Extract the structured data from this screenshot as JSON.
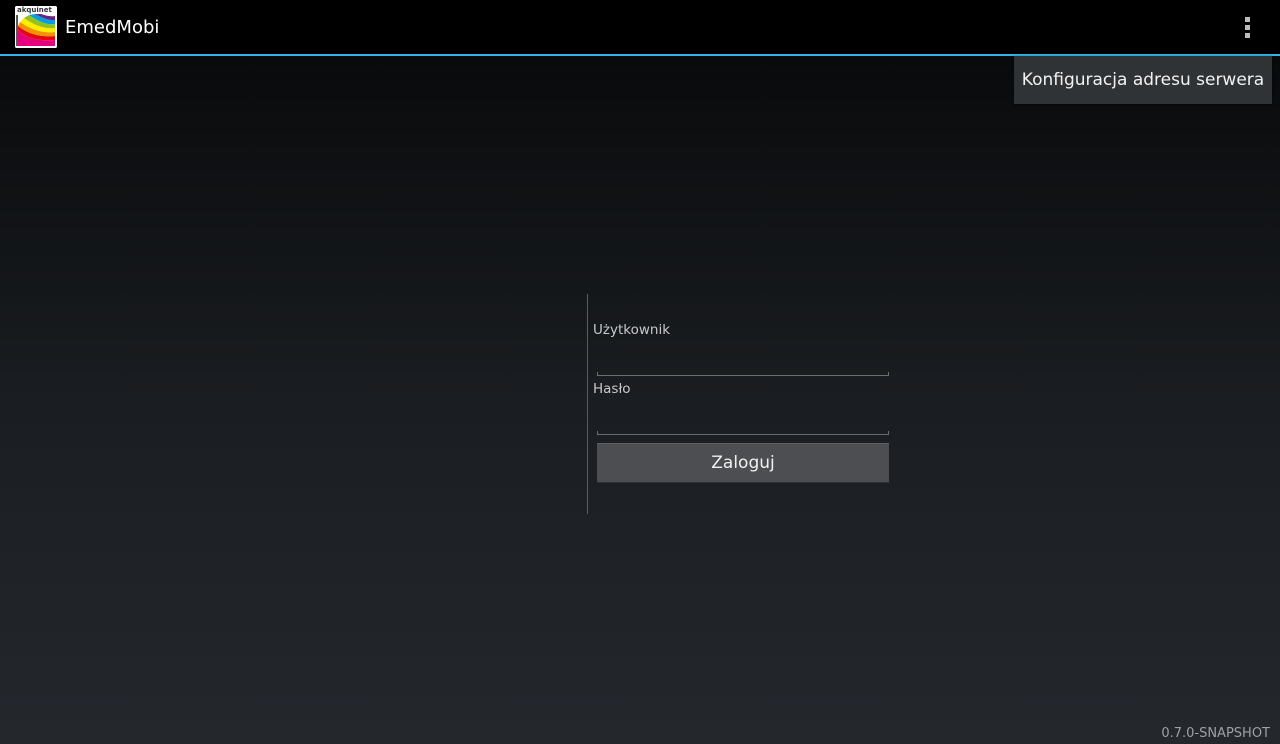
{
  "app": {
    "title": "EmedMobi",
    "icon_text": "akquinet",
    "icon_name": "app-logo-icon",
    "accent_color": "#33b5e5"
  },
  "menu": {
    "overflow_icon": "overflow-menu-icon",
    "items": [
      {
        "label": "Konfiguracja adresu serwera"
      }
    ]
  },
  "login": {
    "username_label": "Użytkownik",
    "username_value": "",
    "password_label": "Hasło",
    "password_value": "",
    "submit_label": "Zaloguj"
  },
  "footer": {
    "version": "0.7.0-SNAPSHOT"
  }
}
